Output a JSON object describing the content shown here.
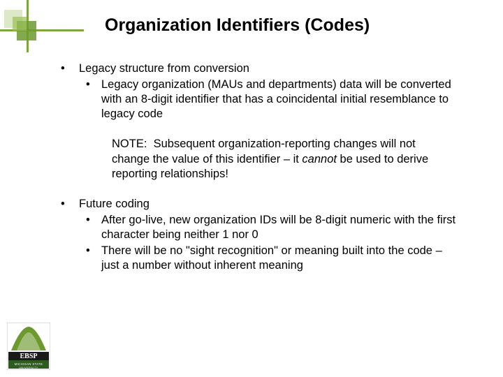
{
  "title": "Organization Identifiers (Codes)",
  "section1": {
    "heading": "Legacy structure from conversion",
    "sub1": "Legacy organization (MAUs and departments) data will be converted with an 8-digit identifier that has a coincidental initial resemblance to legacy code"
  },
  "note": {
    "label": "NOTE:",
    "text1": "Subsequent organization-reporting changes will not change the value of this identifier – it ",
    "emph": "cannot",
    "text2": " be used to derive reporting relationships!"
  },
  "section2": {
    "heading": "Future coding",
    "sub1": "After go-live, new organization IDs will be 8-digit numeric with the first character being neither 1 nor 0",
    "sub2": "There will be no \"sight recognition\" or meaning built into the code – just a number without inherent meaning"
  },
  "logo": {
    "line1": "EBSP",
    "line2": "MICHIGAN STATE"
  }
}
